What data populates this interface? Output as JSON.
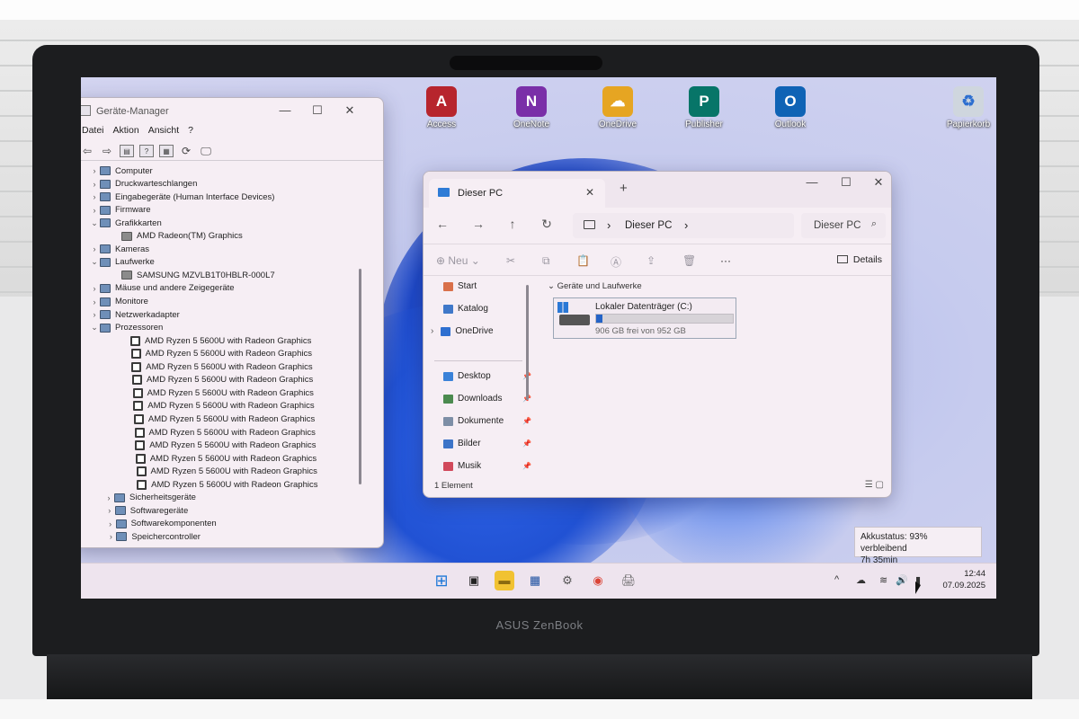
{
  "desktop": {
    "icons": [
      {
        "label": "Access",
        "color": "#b7252d",
        "glyph": "A"
      },
      {
        "label": "OneNote",
        "color": "#7a2fa8",
        "glyph": "N"
      },
      {
        "label": "OneDrive",
        "color": "#e6a522",
        "glyph": "☁"
      },
      {
        "label": "Publisher",
        "color": "#077568",
        "glyph": "P"
      },
      {
        "label": "Outlook",
        "color": "#0f63b5",
        "glyph": "O"
      },
      {
        "label": "Papierkorb",
        "color": "#cfd6de",
        "glyph": "♻"
      }
    ]
  },
  "device_manager": {
    "title": "Geräte-Manager",
    "menu": [
      "Datei",
      "Aktion",
      "Ansicht",
      "?"
    ],
    "tree": [
      {
        "label": "Computer",
        "level": 0,
        "expand": "›"
      },
      {
        "label": "Druckwarteschlangen",
        "level": 0,
        "expand": "›"
      },
      {
        "label": "Eingabegeräte (Human Interface Devices)",
        "level": 0,
        "expand": "›"
      },
      {
        "label": "Firmware",
        "level": 0,
        "expand": "›"
      },
      {
        "label": "Grafikkarten",
        "level": 0,
        "expand": "⌄"
      },
      {
        "label": "AMD Radeon(TM) Graphics",
        "level": 1,
        "expand": ""
      },
      {
        "label": "Kameras",
        "level": 0,
        "expand": "›"
      },
      {
        "label": "Laufwerke",
        "level": 0,
        "expand": "⌄"
      },
      {
        "label": "SAMSUNG MZVLB1T0HBLR-000L7",
        "level": 1,
        "expand": ""
      },
      {
        "label": "Mäuse und andere Zeigegeräte",
        "level": 0,
        "expand": "›"
      },
      {
        "label": "Monitore",
        "level": 0,
        "expand": "›"
      },
      {
        "label": "Netzwerkadapter",
        "level": 0,
        "expand": "›"
      },
      {
        "label": "Prozessoren",
        "level": 0,
        "expand": "⌄"
      },
      {
        "label": "AMD Ryzen 5 5600U with Radeon Graphics",
        "level": 1,
        "expand": "",
        "cpu": true
      },
      {
        "label": "AMD Ryzen 5 5600U with Radeon Graphics",
        "level": 1,
        "expand": "",
        "cpu": true
      },
      {
        "label": "AMD Ryzen 5 5600U with Radeon Graphics",
        "level": 1,
        "expand": "",
        "cpu": true
      },
      {
        "label": "AMD Ryzen 5 5600U with Radeon Graphics",
        "level": 1,
        "expand": "",
        "cpu": true
      },
      {
        "label": "AMD Ryzen 5 5600U with Radeon Graphics",
        "level": 1,
        "expand": "",
        "cpu": true
      },
      {
        "label": "AMD Ryzen 5 5600U with Radeon Graphics",
        "level": 1,
        "expand": "",
        "cpu": true
      },
      {
        "label": "AMD Ryzen 5 5600U with Radeon Graphics",
        "level": 1,
        "expand": "",
        "cpu": true
      },
      {
        "label": "AMD Ryzen 5 5600U with Radeon Graphics",
        "level": 1,
        "expand": "",
        "cpu": true
      },
      {
        "label": "AMD Ryzen 5 5600U with Radeon Graphics",
        "level": 1,
        "expand": "",
        "cpu": true
      },
      {
        "label": "AMD Ryzen 5 5600U with Radeon Graphics",
        "level": 1,
        "expand": "",
        "cpu": true
      },
      {
        "label": "AMD Ryzen 5 5600U with Radeon Graphics",
        "level": 1,
        "expand": "",
        "cpu": true
      },
      {
        "label": "AMD Ryzen 5 5600U with Radeon Graphics",
        "level": 1,
        "expand": "",
        "cpu": true
      },
      {
        "label": "Sicherheitsgeräte",
        "level": 0,
        "expand": "›"
      },
      {
        "label": "Softwaregeräte",
        "level": 0,
        "expand": "›"
      },
      {
        "label": "Softwarekomponenten",
        "level": 0,
        "expand": "›"
      },
      {
        "label": "Speichercontroller",
        "level": 0,
        "expand": "›"
      }
    ]
  },
  "explorer": {
    "tab_title": "Dieser PC",
    "address": "Dieser PC",
    "search_placeholder": "Dieser PC",
    "new_label": "Neu",
    "details_label": "Details",
    "nav": [
      {
        "label": "Start",
        "icon": "home-icon",
        "color": "#d9704a",
        "pinned": false
      },
      {
        "label": "Katalog",
        "icon": "gallery-icon",
        "color": "#3f78c9",
        "pinned": false
      },
      {
        "label": "OneDrive",
        "icon": "onedrive-icon",
        "color": "#2e6fd0",
        "pinned": false
      },
      {
        "label": "Desktop",
        "icon": "desktop-icon",
        "color": "#3a82d8",
        "pinned": true
      },
      {
        "label": "Downloads",
        "icon": "downloads-icon",
        "color": "#4b8a4f",
        "pinned": true
      },
      {
        "label": "Dokumente",
        "icon": "documents-icon",
        "color": "#7d8ea6",
        "pinned": true
      },
      {
        "label": "Bilder",
        "icon": "pictures-icon",
        "color": "#3c74c8",
        "pinned": true
      },
      {
        "label": "Musik",
        "icon": "music-icon",
        "color": "#d1495b",
        "pinned": true
      }
    ],
    "section_title": "Geräte und Laufwerke",
    "drive": {
      "name": "Lokaler Datenträger (C:)",
      "free_text": "906 GB frei von 952 GB",
      "used_fraction": 0.048
    },
    "status": "1 Element"
  },
  "battery_tooltip": {
    "line1": "Akkustatus: 93% verbleibend",
    "line2": "7h 35min"
  },
  "taskbar": {
    "time": "12:44",
    "date": "07.09.2025"
  },
  "bezel": {
    "brand": "ASUS ZenBook"
  }
}
